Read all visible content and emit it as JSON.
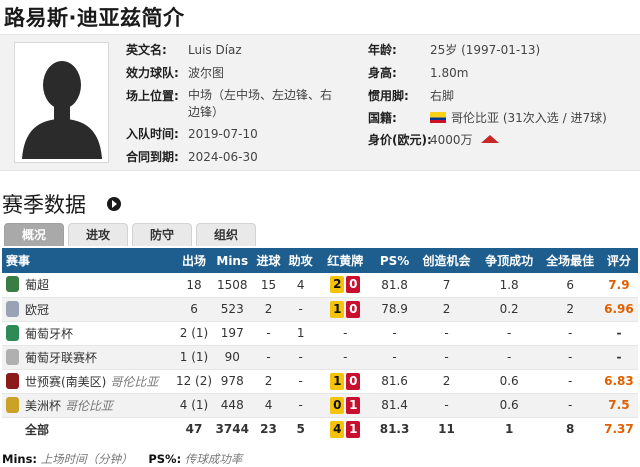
{
  "title": "路易斯·迪亚兹简介",
  "profile": {
    "rows_left": [
      {
        "label": "英文名:",
        "value": "Luis Díaz"
      },
      {
        "label": "效力球队:",
        "value": "波尔图"
      },
      {
        "label": "场上位置:",
        "value": "中场（左中场、左边锋、右边锋）"
      },
      {
        "label": "入队时间:",
        "value": "2019-07-10"
      },
      {
        "label": "合同到期:",
        "value": "2024-06-30"
      }
    ],
    "age_label": "年龄:",
    "age_value": "25岁 (1997-01-13)",
    "height_label": "身高:",
    "height_value": "1.80m",
    "foot_label": "惯用脚:",
    "foot_value": "右脚",
    "nation_label": "国籍:",
    "nation_value": "哥伦比亚 (31次入选 / 进7球)",
    "value_label": "身价(欧元):",
    "value_value": "4000万",
    "flag_colors": [
      "#fcd116",
      "#003893",
      "#ce1126"
    ],
    "trend_icon": "up-arrow-icon",
    "trend_color": "#c62828"
  },
  "section": {
    "title": "赛季数据",
    "more_icon": "circle-arrow-right-icon"
  },
  "tabs": [
    {
      "label": "概况",
      "active": true
    },
    {
      "label": "进攻",
      "active": false
    },
    {
      "label": "防守",
      "active": false
    },
    {
      "label": "组织",
      "active": false
    }
  ],
  "table": {
    "headers": [
      "赛事",
      "出场",
      "Mins",
      "进球",
      "助攻",
      "红黄牌",
      "PS%",
      "创造机会",
      "争顶成功",
      "全场最佳",
      "评分"
    ],
    "rows": [
      {
        "name": "葡超",
        "note": "",
        "apps": "18",
        "mins": "1508",
        "goals": "15",
        "assists": "4",
        "yellow": "2",
        "red": "0",
        "ps": "81.8",
        "chances": "7",
        "aerials": "1.8",
        "motm": "6",
        "rating": "7.9",
        "rating_color": "#e06000",
        "icon_color": "#3a7d44"
      },
      {
        "name": "欧冠",
        "note": "",
        "apps": "6",
        "mins": "523",
        "goals": "2",
        "assists": "-",
        "yellow": "1",
        "red": "0",
        "ps": "78.9",
        "chances": "2",
        "aerials": "0.2",
        "motm": "2",
        "rating": "6.96",
        "rating_color": "#e06000",
        "icon_color": "#9aa3b5"
      },
      {
        "name": "葡萄牙杯",
        "note": "",
        "apps": "2 (1)",
        "mins": "197",
        "goals": "-",
        "assists": "1",
        "yellow": "",
        "red": "",
        "ps": "-",
        "chances": "-",
        "aerials": "-",
        "motm": "-",
        "rating": "-",
        "rating_color": "#333333",
        "icon_color": "#2e8b57"
      },
      {
        "name": "葡萄牙联赛杯",
        "note": "",
        "apps": "1 (1)",
        "mins": "90",
        "goals": "-",
        "assists": "-",
        "yellow": "",
        "red": "",
        "ps": "-",
        "chances": "-",
        "aerials": "-",
        "motm": "-",
        "rating": "-",
        "rating_color": "#333333",
        "icon_color": "#b0b0b0"
      },
      {
        "name": "世预赛(南美区)",
        "note": "哥伦比亚",
        "apps": "12 (2)",
        "mins": "978",
        "goals": "2",
        "assists": "-",
        "yellow": "1",
        "red": "0",
        "ps": "81.6",
        "chances": "2",
        "aerials": "0.6",
        "motm": "-",
        "rating": "6.83",
        "rating_color": "#e06000",
        "icon_color": "#8b1a1a"
      },
      {
        "name": "美洲杯",
        "note": "哥伦比亚",
        "apps": "4 (1)",
        "mins": "448",
        "goals": "4",
        "assists": "-",
        "yellow": "0",
        "red": "1",
        "ps": "81.4",
        "chances": "-",
        "aerials": "0.6",
        "motm": "-",
        "rating": "7.5",
        "rating_color": "#e06000",
        "icon_color": "#c9a227"
      }
    ],
    "total": {
      "name": "全部",
      "apps": "47",
      "mins": "3744",
      "goals": "23",
      "assists": "5",
      "yellow": "4",
      "red": "1",
      "ps": "81.3",
      "chances": "11",
      "aerials": "1",
      "motm": "8",
      "rating": "7.37",
      "rating_color": "#e06000"
    }
  },
  "footnote": {
    "mins_key": "Mins:",
    "mins_desc": "上场时间（分钟）",
    "ps_key": "PS%:",
    "ps_desc": "传球成功率"
  },
  "colors": {
    "header_blue": "#1e5e8e",
    "yellow_card": "#f4c30a",
    "red_card": "#c8102e",
    "tab_active": "#a9a9a9"
  }
}
